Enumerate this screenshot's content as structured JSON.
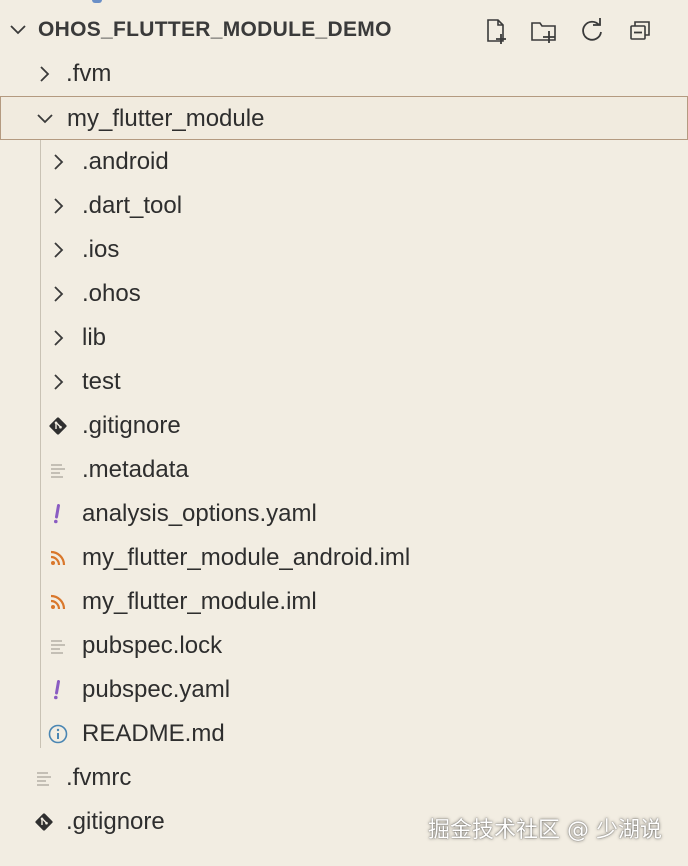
{
  "project": {
    "title": "OHOS_FLUTTER_MODULE_DEMO",
    "actions": [
      {
        "name": "new-file-icon"
      },
      {
        "name": "new-folder-icon"
      },
      {
        "name": "refresh-icon"
      },
      {
        "name": "collapse-all-icon"
      }
    ]
  },
  "tree": {
    "items": [
      {
        "label": ".fvm",
        "kind": "folder",
        "state": "collapsed",
        "depth": 1
      },
      {
        "label": "my_flutter_module",
        "kind": "folder",
        "state": "expanded",
        "depth": 1,
        "selected": true
      },
      {
        "label": ".android",
        "kind": "folder",
        "state": "collapsed",
        "depth": 2
      },
      {
        "label": ".dart_tool",
        "kind": "folder",
        "state": "collapsed",
        "depth": 2
      },
      {
        "label": ".ios",
        "kind": "folder",
        "state": "collapsed",
        "depth": 2
      },
      {
        "label": ".ohos",
        "kind": "folder",
        "state": "collapsed",
        "depth": 2
      },
      {
        "label": "lib",
        "kind": "folder",
        "state": "collapsed",
        "depth": 2
      },
      {
        "label": "test",
        "kind": "folder",
        "state": "collapsed",
        "depth": 2
      },
      {
        "label": ".gitignore",
        "kind": "file",
        "icon": "git-icon",
        "depth": 2
      },
      {
        "label": ".metadata",
        "kind": "file",
        "icon": "text-lines-icon",
        "depth": 2
      },
      {
        "label": "analysis_options.yaml",
        "kind": "file",
        "icon": "yaml-exclamation-icon",
        "depth": 2
      },
      {
        "label": "my_flutter_module_android.iml",
        "kind": "file",
        "icon": "rss-icon",
        "depth": 2
      },
      {
        "label": "my_flutter_module.iml",
        "kind": "file",
        "icon": "rss-icon",
        "depth": 2
      },
      {
        "label": "pubspec.lock",
        "kind": "file",
        "icon": "text-lines-icon",
        "depth": 2
      },
      {
        "label": "pubspec.yaml",
        "kind": "file",
        "icon": "yaml-exclamation-icon",
        "depth": 2
      },
      {
        "label": "README.md",
        "kind": "file",
        "icon": "info-icon",
        "depth": 2
      },
      {
        "label": ".fvmrc",
        "kind": "file",
        "icon": "text-lines-icon",
        "depth": 1
      },
      {
        "label": ".gitignore",
        "kind": "file",
        "icon": "git-icon",
        "depth": 1
      }
    ]
  },
  "watermark": "掘金技术社区 @ 少湖说",
  "colors": {
    "background": "#f2ede2",
    "selection_border": "#b49a80",
    "yaml": "#8a5cc2",
    "rss": "#d9772b",
    "info": "#4a86b3",
    "git": "#2f2f2f",
    "lines": "#a9a49a"
  }
}
